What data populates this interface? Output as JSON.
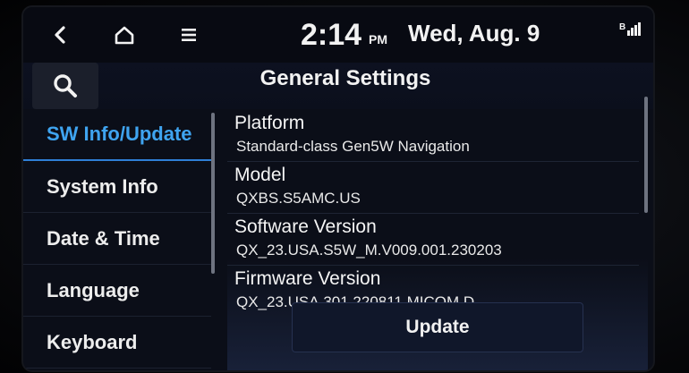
{
  "status_bar": {
    "time": "2:14",
    "ampm": "PM",
    "date": "Wed, Aug. 9",
    "signal_icon": "bluetooth-signal-icon"
  },
  "nav": {
    "back_icon": "back-chevron-icon",
    "home_icon": "home-icon",
    "menu_icon": "menu-icon"
  },
  "header": {
    "search_icon": "search-icon",
    "title": "General Settings"
  },
  "sidebar": {
    "items": [
      {
        "label": "SW Info/Update",
        "active": true
      },
      {
        "label": "System Info",
        "active": false
      },
      {
        "label": "Date & Time",
        "active": false
      },
      {
        "label": "Language",
        "active": false
      },
      {
        "label": "Keyboard",
        "active": false
      }
    ]
  },
  "content": {
    "rows": [
      {
        "label": "Platform",
        "value": "Standard-class Gen5W Navigation"
      },
      {
        "label": "Model",
        "value": "QXBS.S5AMC.US"
      },
      {
        "label": "Software Version",
        "value": "QX_23.USA.S5W_M.V009.001.230203"
      },
      {
        "label": "Firmware Version",
        "value": "QX_23.USA.301.220811.MICOM.D"
      }
    ],
    "update_label": "Update"
  },
  "colors": {
    "accent": "#3fa4f0",
    "background": "#0b0e18"
  }
}
